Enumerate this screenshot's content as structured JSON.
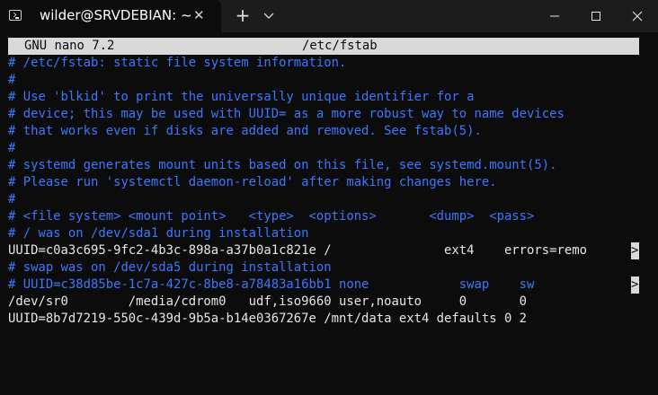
{
  "window": {
    "tab_title": "wilder@SRVDEBIAN: ~",
    "tab_close": "✕",
    "new_tab": "+",
    "icons": {
      "terminal": "terminal-icon",
      "dropdown": "chevron-down-icon",
      "minimize": "minimize-icon",
      "maximize": "maximize-icon",
      "close": "close-icon"
    }
  },
  "nano": {
    "version": "GNU nano 7.2",
    "filename": "/etc/fstab",
    "overflow_marker": ">",
    "lines": [
      "# /etc/fstab: static file system information.",
      "#",
      "# Use 'blkid' to print the universally unique identifier for a",
      "# device; this may be used with UUID= as a more robust way to name devices",
      "# that works even if disks are added and removed. See fstab(5).",
      "#",
      "# systemd generates mount units based on this file, see systemd.mount(5).",
      "# Please run 'systemctl daemon-reload' after making changes here.",
      "#",
      "# <file system> <mount point>   <type>  <options>       <dump>  <pass>",
      "# / was on /dev/sda1 during installation",
      "UUID=c0a3c695-9fc2-4b3c-898a-a37b0a1c821e /               ext4    errors=remo",
      "# swap was on /dev/sda5 during installation",
      "# UUID=c38d85be-1c7a-427c-8be8-a78483a16bb1 none            swap    sw      ",
      "/dev/sr0        /media/cdrom0   udf,iso9660 user,noauto     0       0",
      "UUID=8b7d7219-550c-439d-9b5a-b14e0367267e /mnt/data ext4 defaults 0 2"
    ]
  },
  "colors": {
    "comment": "#3b78ff",
    "text": "#e6e6e6",
    "header_bg": "#d9d9d9"
  }
}
